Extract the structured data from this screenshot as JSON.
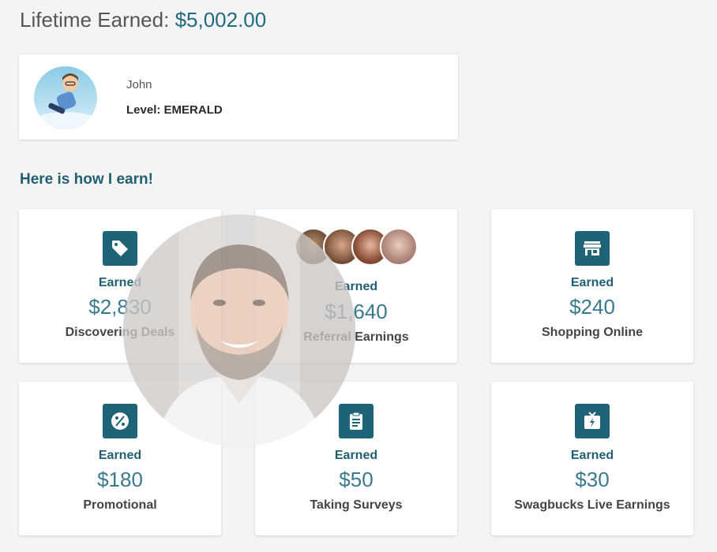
{
  "header": {
    "lifetime_label": "Lifetime Earned:",
    "lifetime_amount": "$5,002.00"
  },
  "profile": {
    "name": "John",
    "level": "Level: EMERALD"
  },
  "section_title": "Here is how I earn!",
  "cards": [
    {
      "earned_label": "Earned",
      "value": "$2,830",
      "label": "Discovering Deals",
      "icon": "price-tag-icon"
    },
    {
      "earned_label": "Earned",
      "value": "$1,640",
      "label": "Referral Earnings",
      "icon": "referral-avatars"
    },
    {
      "earned_label": "Earned",
      "value": "$240",
      "label": "Shopping Online",
      "icon": "storefront-icon"
    },
    {
      "earned_label": "Earned",
      "value": "$180",
      "label": "Promotional",
      "icon": "percent-badge-icon"
    },
    {
      "earned_label": "Earned",
      "value": "$50",
      "label": "Taking Surveys",
      "icon": "clipboard-icon"
    },
    {
      "earned_label": "Earned",
      "value": "$30",
      "label": "Swagbucks Live Earnings",
      "icon": "tv-lightning-icon"
    }
  ],
  "colors": {
    "accent": "#1d6478",
    "value_text": "#3a7a8e",
    "background": "#f4f4f4"
  }
}
